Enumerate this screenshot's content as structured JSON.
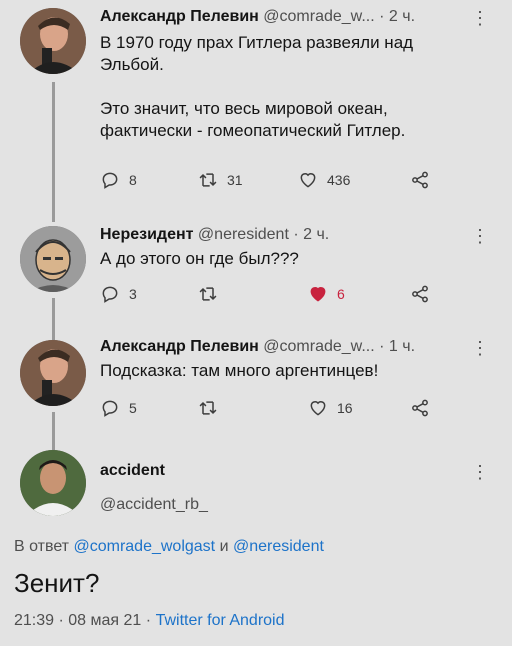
{
  "tweets": [
    {
      "name": "Александр Пелевин",
      "handle": "@comrade_w...",
      "time": "· 2 ч.",
      "text": "В 1970 году прах Гитлера развеяли над\nЭльбой.\n\nЭто значит, что весь мировой океан,\nфактически - гомеопатический Гитлер.",
      "replies": "8",
      "retweets": "31",
      "likes": "436"
    },
    {
      "name": "Нерезидент",
      "handle": "@neresident",
      "time": "· 2 ч.",
      "text": "А до этого он где был???",
      "replies": "3",
      "retweets": "",
      "likes": "6",
      "liked": true
    },
    {
      "name": "Александр Пелевин",
      "handle": "@comrade_w...",
      "time": "· 1 ч.",
      "text": "Подсказка: там много аргентинцев!",
      "replies": "5",
      "retweets": "",
      "likes": "16"
    }
  ],
  "focus": {
    "name": "accident",
    "handle": "@accident_rb_",
    "reply_prefix": "В ответ",
    "reply_user1": "@comrade_wolgast",
    "reply_and": "и",
    "reply_user2": "@neresident",
    "text": "Зенит?",
    "time": "21:39",
    "date": "08 мая 21",
    "source": "Twitter for Android"
  },
  "more_label": "⋮",
  "colors": {
    "like_active": "#c8233f",
    "link": "#1d73c9",
    "background": "#e3e3e3"
  }
}
